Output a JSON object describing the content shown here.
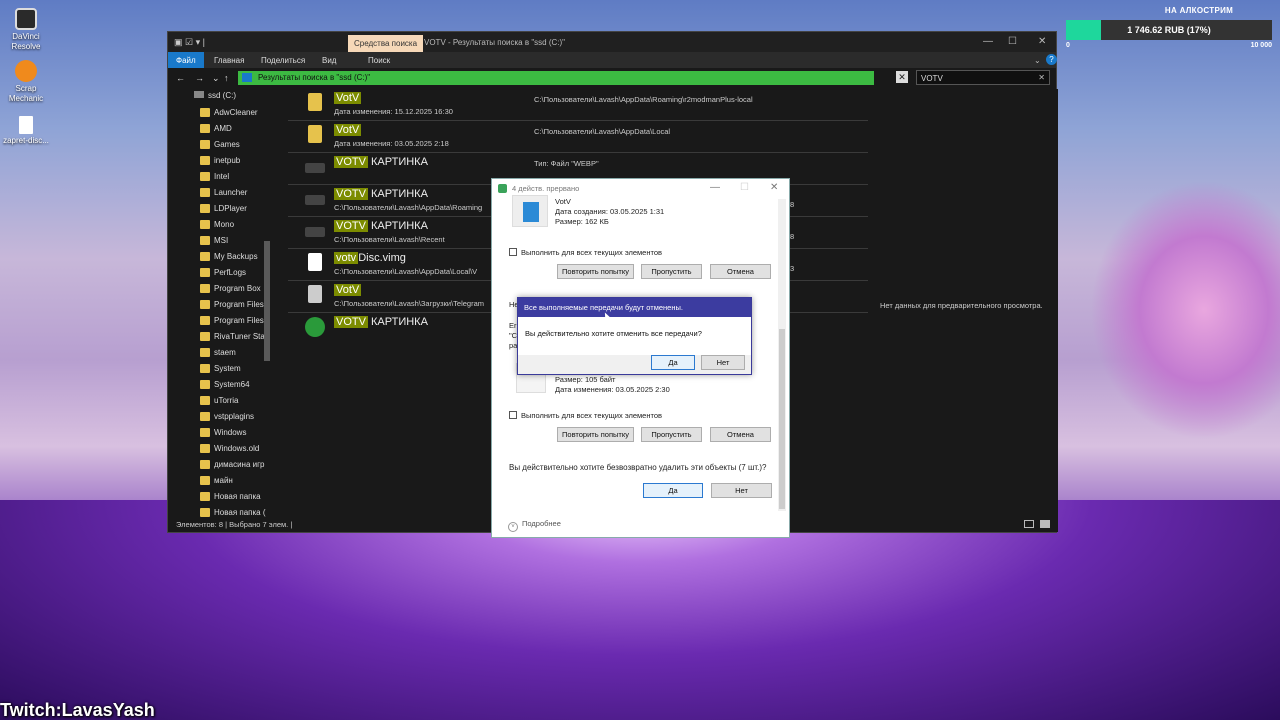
{
  "desktop": {
    "icons": [
      {
        "label": "DaVinci Resolve",
        "icon": "davinci-icon",
        "color": "#2a2a2a"
      },
      {
        "label": "Scrap Mechanic",
        "icon": "scrap-mechanic-icon",
        "color": "#f08a1c"
      },
      {
        "label": "zapret-disc...",
        "icon": "file-icon",
        "color": "#ffffff"
      }
    ]
  },
  "donation": {
    "title": "НА АЛКОСТРИМ",
    "amount": "1 746.62 RUB (17%)",
    "progress": 0.17,
    "min": "0",
    "max": "10 000"
  },
  "overlay": {
    "twitch": "Twitch:LavasYash"
  },
  "explorer": {
    "context_tab": "Средства поиска",
    "title": "VOTV - Результаты поиска в \"ssd (C:)\"",
    "ribbon": {
      "file": "Файл",
      "home": "Главная",
      "share": "Поделиться",
      "view": "Вид",
      "search": "Поиск"
    },
    "address": "Результаты поиска в \"ssd (C:)\"",
    "search_value": "VOTV",
    "drive": "ssd (C:)",
    "sidebar": [
      "AdwCleaner",
      "AMD",
      "Games",
      "inetpub",
      "Intel",
      "Launcher",
      "LDPlayer",
      "Mono",
      "MSI",
      "My Backups",
      "PerfLogs",
      "Program Box",
      "Program Files",
      "Program Files",
      "RivaTuner Stat",
      "staem",
      "System",
      "System64",
      "uTorria",
      "vstpplagins",
      "Windows",
      "Windows.old",
      "димасина игр",
      "майн",
      "Новая папка",
      "Новая папка ("
    ],
    "files": [
      {
        "hl": "VotV",
        "rest": "",
        "sub": "Дата изменения: 15.12.2025 16:30",
        "path": "C:\\Пользователи\\Lavash\\AppData\\Roaming\\r2modmanPlus-local",
        "icon": "folder-icon",
        "color": "#e6c24c"
      },
      {
        "hl": "VotV",
        "rest": "",
        "sub": "Дата изменения: 03.05.2025 2:18",
        "path": "C:\\Пользователи\\Lavash\\AppData\\Local",
        "icon": "folder-icon",
        "color": "#e6c24c"
      },
      {
        "hl": "VOTV",
        "rest": " КАРТИНКА",
        "sub": "",
        "path": "Тип: Файл \"WEBP\"",
        "icon": "image-icon",
        "color": "#444444"
      },
      {
        "hl": "VOTV",
        "rest": " КАРТИНКА",
        "sub": "C:\\Пользователи\\Lavash\\AppData\\Roaming",
        "path": "",
        "icon": "image-icon",
        "color": "#444444"
      },
      {
        "hl": "VOTV",
        "rest": " КАРТИНКА",
        "sub": "C:\\Пользователи\\Lavash\\Recent",
        "path": "",
        "icon": "image-icon",
        "color": "#444444"
      },
      {
        "hl": "votv",
        "rest": "Disc.vimg",
        "sub": "C:\\Пользователи\\Lavash\\AppData\\Local\\V",
        "path": "",
        "icon": "file-icon",
        "color": "#ffffff"
      },
      {
        "hl": "VotV",
        "rest": "",
        "sub": "C:\\Пользователи\\Lavash\\Загрузки\\Telegram",
        "path": "",
        "icon": "satellite-icon",
        "color": "#cccccc"
      },
      {
        "hl": "VOTV",
        "rest": " КАРТИНКА",
        "sub": "",
        "path": "",
        "icon": "globe-icon",
        "color": "#2a9a3a"
      }
    ],
    "preview_text": "Нет данных для предварительного просмотра.",
    "status": "Элементов: 8  |  Выбрано 7 элем.  |"
  },
  "progress_dialog": {
    "title": "4 действ. прервано",
    "item1": {
      "name": "VotV",
      "created": "Дата создания: 03.05.2025 1:31",
      "size": "Размер: 162 КБ"
    },
    "apply_all": "Выполнить для всех текущих элементов",
    "retry": "Повторить попытку",
    "skip": "Пропустить",
    "cancel": "Отмена",
    "side_numbers": [
      "8",
      "8",
      "3"
    ],
    "partial": {
      "a": "Не",
      "b": "Err",
      "c": "\"C",
      "d": "ра"
    },
    "item2": {
      "size": "Размер: 105 байт",
      "modified": "Дата изменения: 03.05.2025 2:30"
    },
    "question": "Вы действительно хотите безвозвратно удалить эти объекты (7 шт.)?",
    "yes": "Да",
    "no": "Нет",
    "more": "Подробнее"
  },
  "confirm_dialog": {
    "title": "Все выполняемые передачи будут отменены.",
    "message": "Вы действительно хотите отменить все передачи?",
    "yes": "Да",
    "no": "Нет"
  }
}
